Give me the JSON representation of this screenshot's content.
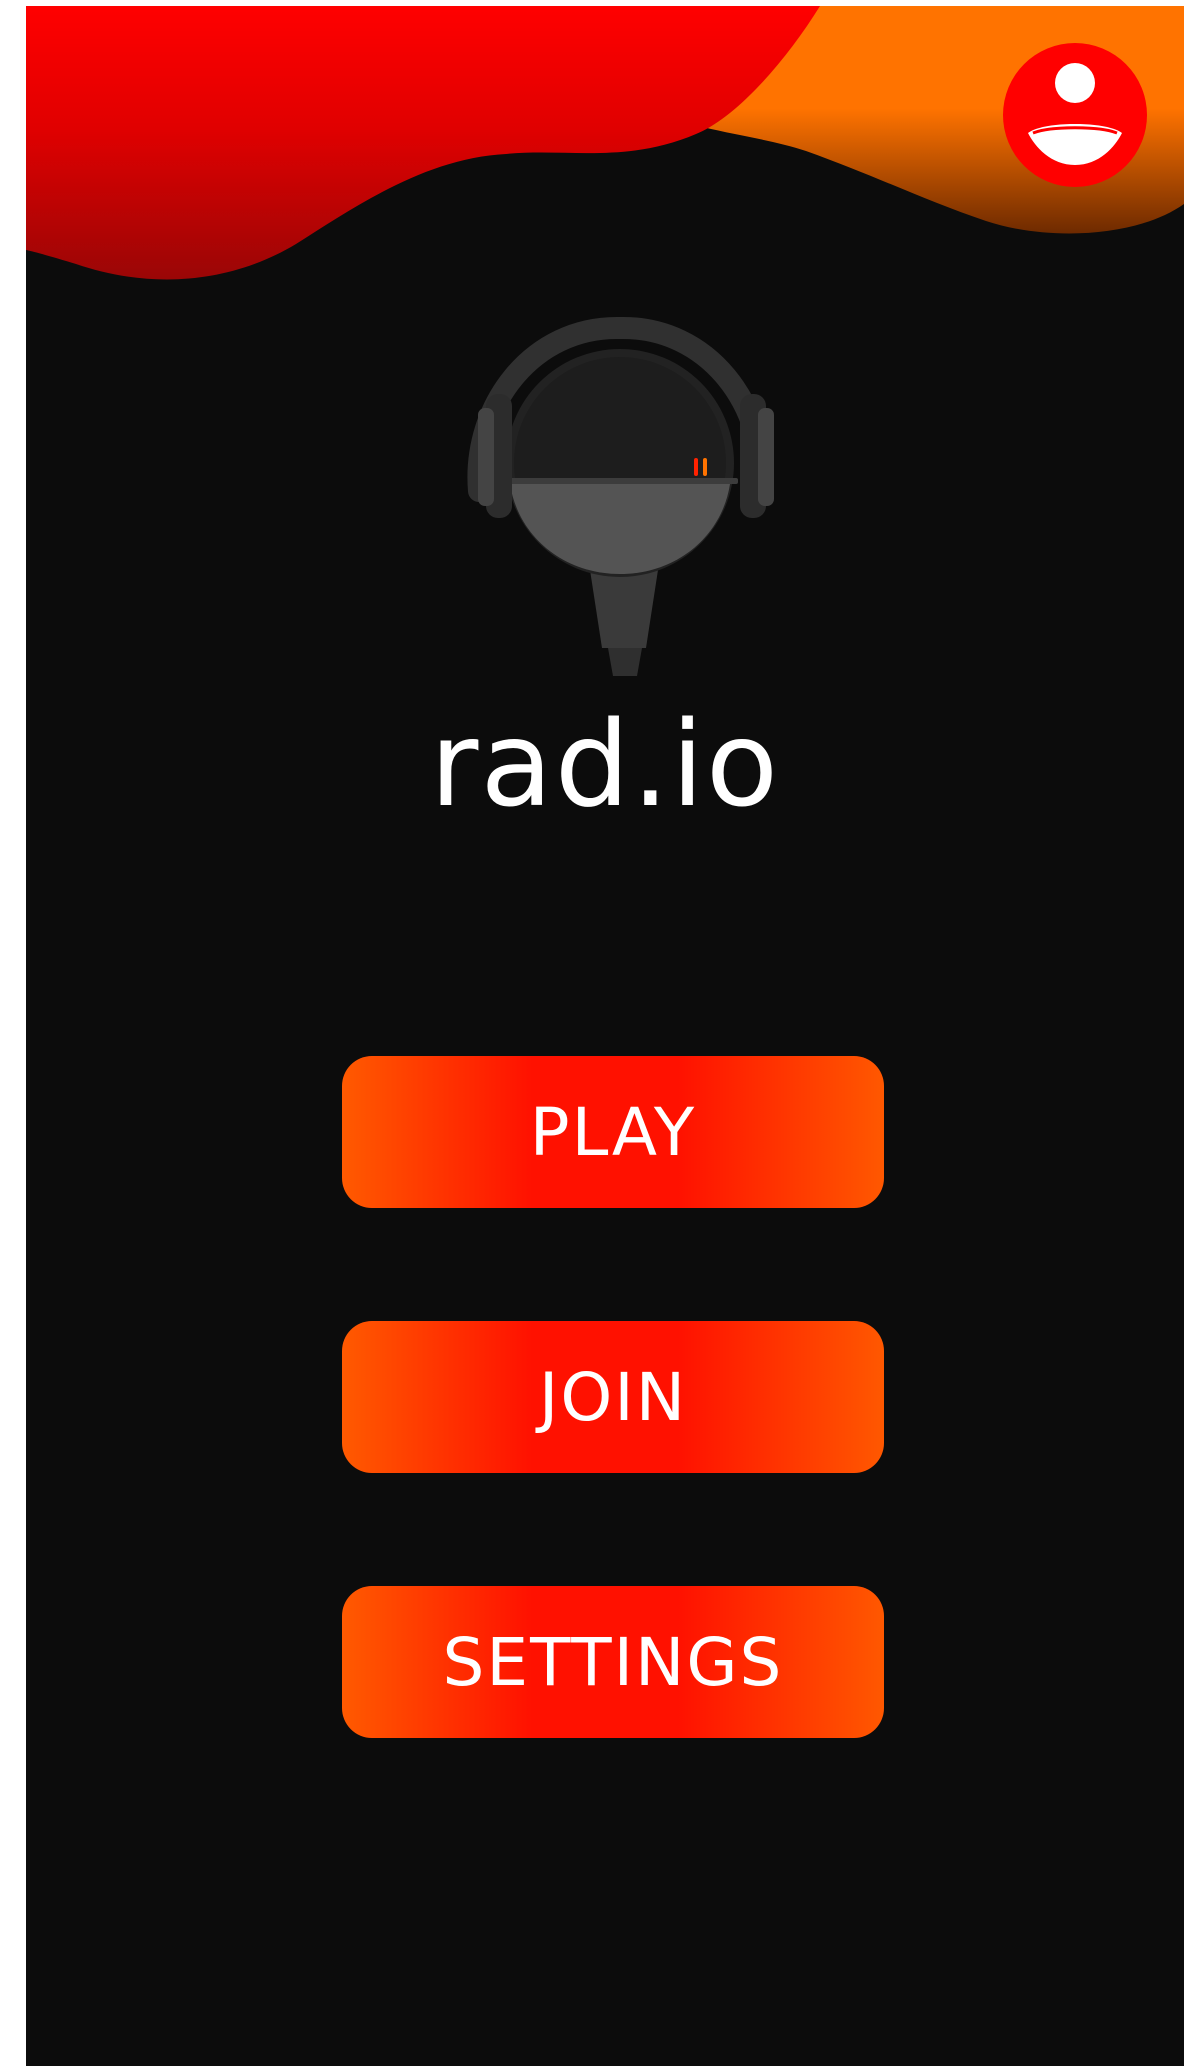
{
  "app": {
    "title": "rad.io"
  },
  "header": {
    "profile_icon": "user-avatar-icon"
  },
  "logo": {
    "icon": "radio-headphones-microphone-logo"
  },
  "menu": {
    "play_label": "PLAY",
    "join_label": "JOIN",
    "settings_label": "SETTINGS"
  },
  "colors": {
    "background": "#0c0c0c",
    "accent_red": "#ff0000",
    "accent_orange": "#ff7300",
    "button_gradient_start": "#ff5a00",
    "button_gradient_mid": "#ff1100",
    "text": "#ffffff"
  }
}
